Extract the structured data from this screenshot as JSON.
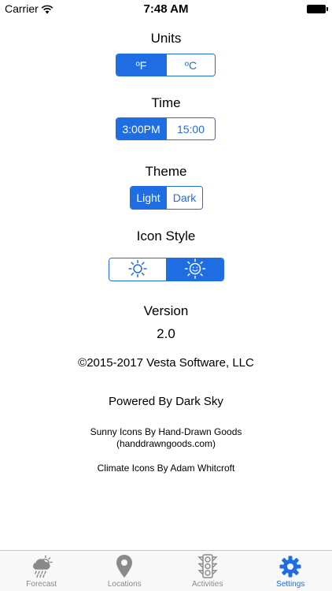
{
  "status_bar": {
    "carrier": "Carrier",
    "time": "7:48 AM"
  },
  "settings": {
    "units": {
      "title": "Units",
      "options": [
        "ºF",
        "ºC"
      ],
      "selected": "ºF"
    },
    "time": {
      "title": "Time",
      "options": [
        "3:00PM",
        "15:00"
      ],
      "selected": "3:00PM"
    },
    "theme": {
      "title": "Theme",
      "options": [
        "Light",
        "Dark"
      ],
      "selected": "Light"
    },
    "icon_style": {
      "title": "Icon Style",
      "options": [
        "sun-icon",
        "smiling-sun-icon"
      ],
      "selected": "smiling-sun-icon"
    },
    "version": {
      "title": "Version",
      "value": "2.0"
    }
  },
  "credits": {
    "copyright": "©2015-2017 Vesta Software, LLC",
    "powered_by": "Powered By Dark Sky",
    "sunny_icons_line1": "Sunny Icons By Hand-Drawn Goods",
    "sunny_icons_line2": "(handdrawngoods.com)",
    "climate_icons": "Climate Icons By Adam Whitcroft"
  },
  "tab_bar": {
    "tabs": [
      {
        "label": "Forecast",
        "icon": "cloud-sun-rain-icon"
      },
      {
        "label": "Locations",
        "icon": "map-pin-icon"
      },
      {
        "label": "Activities",
        "icon": "traffic-light-icon"
      },
      {
        "label": "Settings",
        "icon": "gear-icon"
      }
    ],
    "active": "Settings"
  },
  "colors": {
    "accent": "#1f6de3",
    "tab_inactive": "#8a8a8a",
    "tab_bar_bg": "#f8f8f8"
  }
}
